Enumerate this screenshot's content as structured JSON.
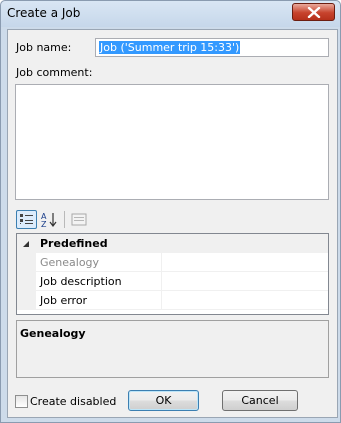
{
  "window": {
    "title": "Create a Job"
  },
  "form": {
    "job_name_label": "Job name:",
    "job_name_value": "Job ('Summer trip 15:33')",
    "job_comment_label": "Job comment:",
    "job_comment_value": ""
  },
  "toolbar": {
    "categorized": "categorized-view-icon",
    "alphabetical": "alphabetical-sort-icon",
    "property_pages": "property-pages-icon"
  },
  "properties": {
    "category": "Predefined",
    "items": [
      {
        "name": "Genealogy",
        "value": "",
        "disabled": true
      },
      {
        "name": "Job description",
        "value": "",
        "disabled": false
      },
      {
        "name": "Job error",
        "value": "",
        "disabled": false
      }
    ]
  },
  "help": {
    "title": "Genealogy",
    "text": ""
  },
  "footer": {
    "create_disabled_label": "Create disabled",
    "create_disabled_checked": false,
    "ok_label": "OK",
    "cancel_label": "Cancel"
  }
}
